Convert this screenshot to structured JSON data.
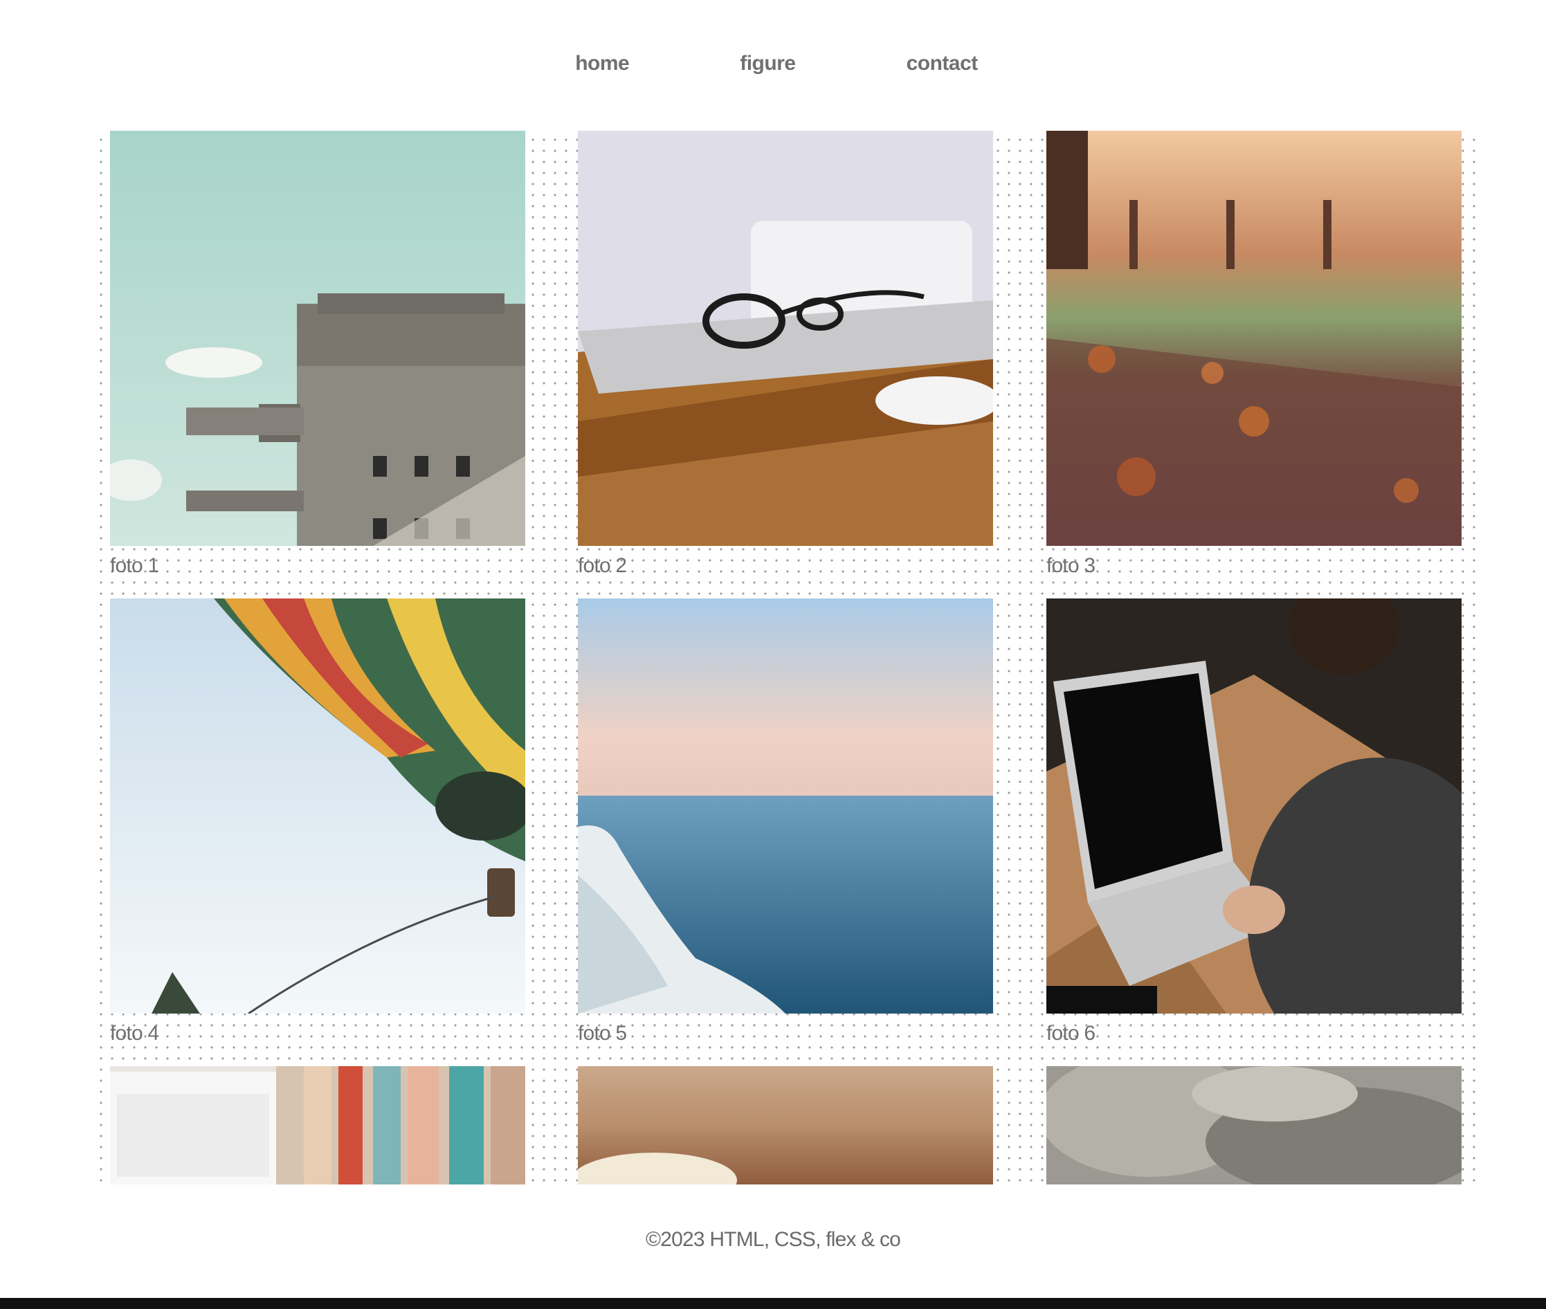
{
  "nav": {
    "items": [
      {
        "label": "home"
      },
      {
        "label": "figure"
      },
      {
        "label": "contact"
      }
    ]
  },
  "gallery": {
    "photos": [
      {
        "caption": "foto 1",
        "subject": "concrete-building-sky"
      },
      {
        "caption": "foto 2",
        "subject": "glasses-on-laptop-desk"
      },
      {
        "caption": "foto 3",
        "subject": "autumn-leaves-path"
      },
      {
        "caption": "foto 4",
        "subject": "hot-air-balloon"
      },
      {
        "caption": "foto 5",
        "subject": "sea-cliff-horizon"
      },
      {
        "caption": "foto 6",
        "subject": "person-typing-laptop"
      },
      {
        "caption": "",
        "subject": "keyboard-and-books"
      },
      {
        "caption": "",
        "subject": "blurred-cup"
      },
      {
        "caption": "",
        "subject": "fur-texture"
      }
    ]
  },
  "footer": {
    "text": "©2023 HTML, CSS, flex & co"
  }
}
